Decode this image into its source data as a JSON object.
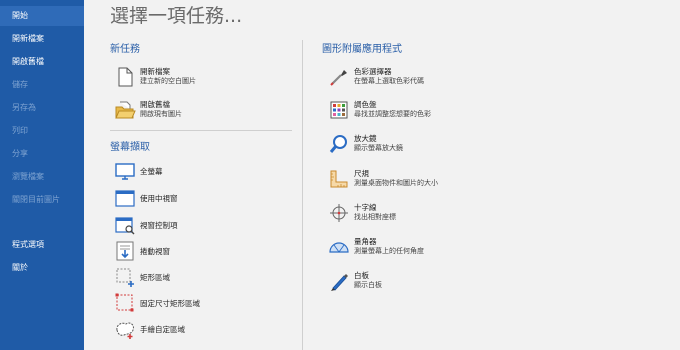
{
  "sidebar": {
    "items": [
      {
        "label": "開始",
        "enabled": true,
        "active": true
      },
      {
        "label": "開新檔案",
        "enabled": true
      },
      {
        "label": "開啟舊檔",
        "enabled": true
      },
      {
        "label": "儲存",
        "enabled": false
      },
      {
        "label": "另存為",
        "enabled": false
      },
      {
        "label": "列印",
        "enabled": false
      },
      {
        "label": "分享",
        "enabled": false
      },
      {
        "label": "瀏覽檔案",
        "enabled": false
      },
      {
        "label": "關閉目前圖片",
        "enabled": false
      },
      {
        "label": "程式選項",
        "enabled": true
      },
      {
        "label": "關於",
        "enabled": true
      }
    ]
  },
  "main": {
    "title": "選擇一項任務...",
    "new_task": {
      "title": "新任務",
      "items": [
        {
          "label": "開新檔案",
          "desc": "建立新的空白圖片",
          "icon": "blank-page-icon"
        },
        {
          "label": "開啟舊檔",
          "desc": "開啟現有圖片",
          "icon": "folder-open-icon"
        }
      ]
    },
    "capture": {
      "title": "螢幕擷取",
      "items": [
        {
          "label": "全螢幕",
          "icon": "monitor-icon"
        },
        {
          "label": "使用中視窗",
          "icon": "window-icon"
        },
        {
          "label": "視窗控制項",
          "icon": "window-control-icon"
        },
        {
          "label": "捲動視窗",
          "icon": "scroll-window-icon"
        },
        {
          "label": "矩形區域",
          "icon": "rectangle-region-icon"
        },
        {
          "label": "固定尺寸矩形區域",
          "icon": "fixed-rectangle-icon"
        },
        {
          "label": "手繪自定區域",
          "icon": "freehand-region-icon"
        }
      ]
    },
    "accessories": {
      "title": "圖形附屬應用程式",
      "items": [
        {
          "label": "色彩選擇器",
          "desc": "在螢幕上選取色彩代碼",
          "icon": "eyedropper-icon"
        },
        {
          "label": "調色盤",
          "desc": "尋找並調整您想要的色彩",
          "icon": "palette-icon"
        },
        {
          "label": "放大鏡",
          "desc": "顯示螢幕放大鏡",
          "icon": "magnifier-icon"
        },
        {
          "label": "尺規",
          "desc": "測量桌面物件和圖片的大小",
          "icon": "ruler-icon"
        },
        {
          "label": "十字線",
          "desc": "找出相對座標",
          "icon": "crosshair-icon"
        },
        {
          "label": "量角器",
          "desc": "測量螢幕上的任何角度",
          "icon": "protractor-icon"
        },
        {
          "label": "白板",
          "desc": "顯示白板",
          "icon": "whiteboard-pen-icon"
        }
      ]
    }
  },
  "colors": {
    "sidebar_bg": "#1f5ba7",
    "sidebar_active": "#2f6bb8",
    "sidebar_disabled_text": "#7ea3d1",
    "accent": "#2a5fa8",
    "icon_blue": "#2b6cc4"
  }
}
